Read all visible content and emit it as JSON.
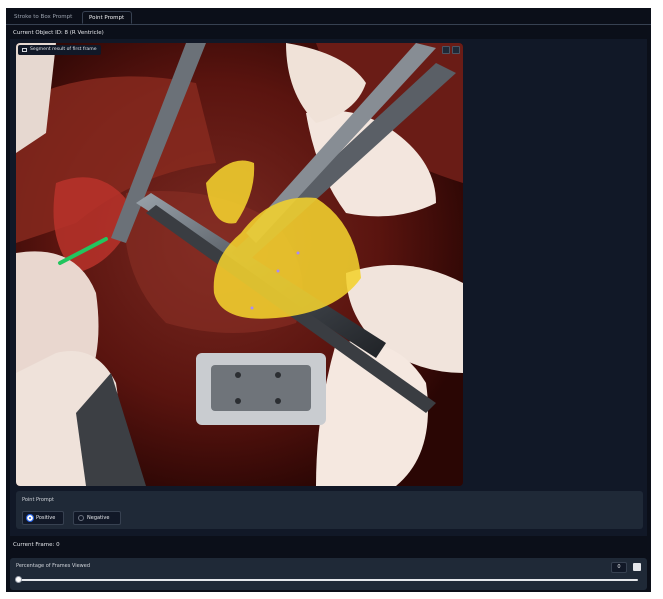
{
  "tabs": [
    {
      "label": "Stroke to Box Prompt",
      "active": false
    },
    {
      "label": "Point Prompt",
      "active": true
    }
  ],
  "object_title": "Current Object ID: 8 (R Ventricle)",
  "image": {
    "label": "Segment result of first frame",
    "tool_icons": [
      "download-icon",
      "fullscreen-icon"
    ]
  },
  "point_prompt": {
    "label": "Point Prompt",
    "options": [
      "Positive",
      "Negative"
    ],
    "selected": "Positive"
  },
  "current_frame": "Current Frame: 0",
  "slider": {
    "label": "Percentage of Frames Viewed",
    "value": "0",
    "fraction": 0
  },
  "colors": {
    "background": "#0b0f19",
    "panel": "#1f2937",
    "accent": "#2563eb",
    "mask": "#f2d12e",
    "positive_point": "#22c55e"
  }
}
